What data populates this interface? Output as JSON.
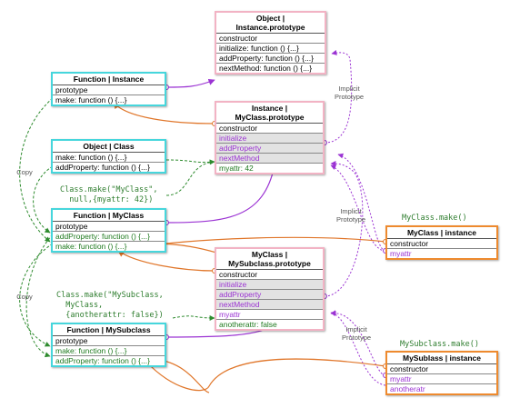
{
  "boxes": {
    "obj_instance_proto": {
      "title": "Object |\nInstance.prototype",
      "rows": [
        "constructor",
        "initialize: function () {...}",
        "addProperty: function () {...}",
        "nextMethod: function () {...}"
      ]
    },
    "fn_instance": {
      "title": "Function | Instance",
      "rows": [
        "prototype",
        "make: function () {...}"
      ]
    },
    "myclass_proto": {
      "title": "Instance |\nMyClass.prototype",
      "rows": [
        "constructor",
        "initialize",
        "addProperty",
        "nextMethod",
        "myattr: 42"
      ]
    },
    "obj_class": {
      "title": "Object | Class",
      "rows": [
        "make: function () {...}",
        "addProperty: function () {...}"
      ]
    },
    "fn_myclass": {
      "title": "Function | MyClass",
      "rows": [
        "prototype",
        "addProperty: function () {...}",
        "make: function () {...}"
      ]
    },
    "myclass_instance": {
      "title": "MyClass | instance",
      "rows": [
        "constructor",
        "myattr"
      ]
    },
    "mysubclass_proto": {
      "title": "MyClass |\nMySubclass.prototype",
      "rows": [
        "constructor",
        "initialize",
        "addProperty",
        "nextMethod",
        "myattr",
        "anotherattr: false"
      ]
    },
    "fn_mysubclass": {
      "title": "Function | MySubclass",
      "rows": [
        "prototype",
        "make: function () {...}",
        "addProperty: function () {...}"
      ]
    },
    "mysubclass_instance": {
      "title": "MySublass | instance",
      "rows": [
        "constructor",
        "myattr",
        "anotheratr"
      ]
    }
  },
  "code": {
    "make_myclass": "Class.make(\"MyClass\",\n  null,{myattr: 42})",
    "make_mysubclass": "Class.make(\"MySubclass,\n  MyClass,\n  {anotherattr: false})",
    "myclass_make_call": "MyClass.make()",
    "mysubclass_make_call": "MySubclass.make()"
  },
  "labels": {
    "implicit_prototype": "Implicit\nPrototype",
    "copy": "Copy"
  },
  "colors": {
    "pink_border": "#f2b3c4",
    "cyan_border": "#46d6dc",
    "orange_border": "#ee8a2e",
    "purple": "#9b33d3",
    "green": "#1f7a1f",
    "orange": "#e0762a"
  }
}
